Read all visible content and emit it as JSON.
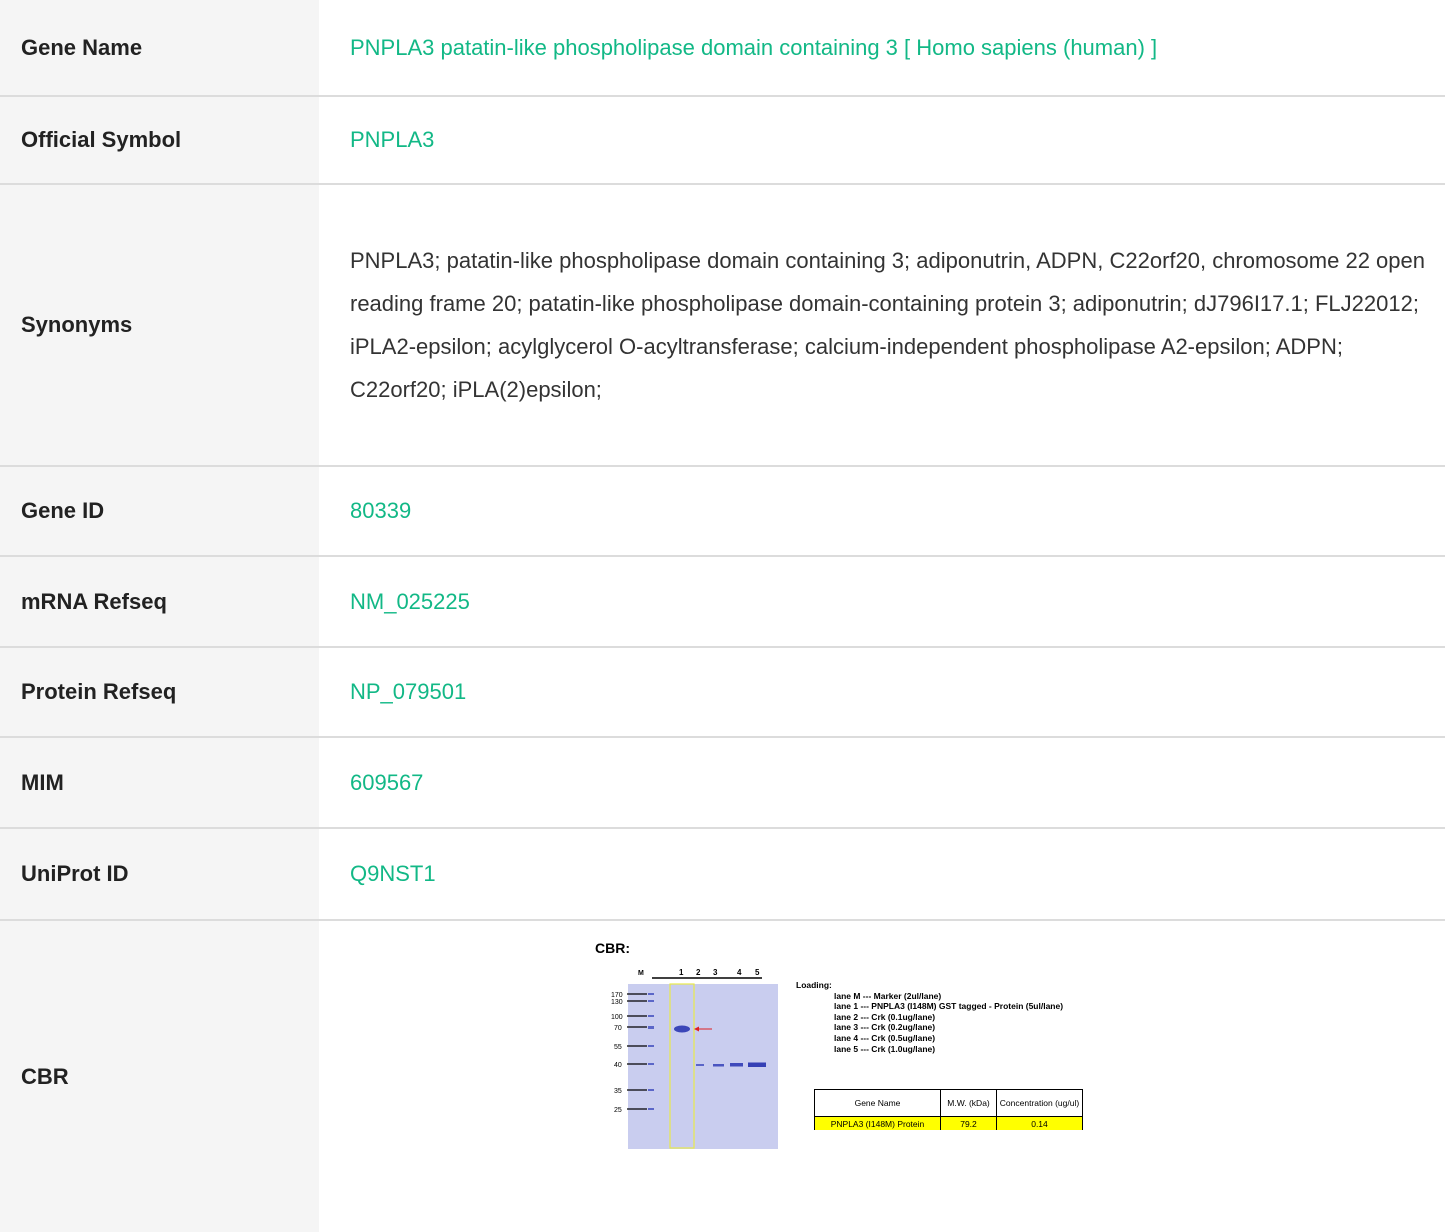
{
  "rows": [
    {
      "label": "Gene Name",
      "value": "PNPLA3 patatin-like phospholipase domain containing 3 [ Homo sapiens (human) ]"
    },
    {
      "label": "Official Symbol",
      "value": "PNPLA3"
    },
    {
      "label": "Synonyms",
      "value": "PNPLA3; patatin-like phospholipase domain containing 3; adiponutrin, ADPN, C22orf20, chromosome 22 open reading frame 20; patatin-like phospholipase domain-containing protein 3; adiponutrin; dJ796I17.1; FLJ22012; iPLA2-epsilon; acylglycerol O-acyltransferase; calcium-independent phospholipase A2-epsilon; ADPN; C22orf20; iPLA(2)epsilon;"
    },
    {
      "label": "Gene ID",
      "value": "80339"
    },
    {
      "label": "mRNA Refseq",
      "value": "NM_025225"
    },
    {
      "label": "Protein Refseq",
      "value": "NP_079501"
    },
    {
      "label": "MIM",
      "value": "609567"
    },
    {
      "label": "UniProt ID",
      "value": "Q9NST1"
    },
    {
      "label": "CBR"
    }
  ],
  "cbr_figure": {
    "title": "CBR:",
    "gel": {
      "marker_lane_label": "M",
      "lane_labels": [
        "1",
        "2",
        "3",
        "4",
        "5"
      ],
      "marker_sizes": [
        "170",
        "130",
        "100",
        "70",
        "55",
        "40",
        "35",
        "25"
      ]
    },
    "loading": {
      "heading": "Loading:",
      "lines": [
        "lane M   --- Marker (2ul/lane)",
        "lane 1   --- PNPLA3 (I148M) GST tagged - Protein (5ul/lane)",
        "lane 2   --- Crk (0.1ug/lane)",
        "lane 3   --- Crk (0.2ug/lane)",
        "lane 4   --- Crk (0.5ug/lane)",
        "lane 5   --- Crk (1.0ug/lane)"
      ]
    },
    "table": {
      "headers": [
        "Gene Name",
        "M.W. (kDa)",
        "Concentration (ug/ul)"
      ],
      "row": [
        "PNPLA3 (I148M) Protein",
        "79.2",
        "0.14"
      ]
    }
  },
  "colors": {
    "link": "#12b886",
    "label_bg": "#f5f5f5",
    "divider": "#dcdcdc",
    "gel_bg": "#c9cdef",
    "band": "#3b46b8",
    "highlight": "#ffff00"
  }
}
